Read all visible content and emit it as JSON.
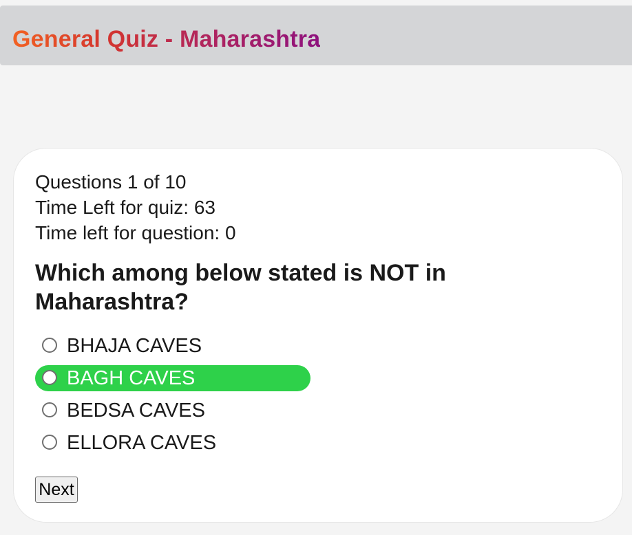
{
  "header": {
    "title": "General Quiz - Maharashtra"
  },
  "quiz": {
    "question_counter": "Questions 1 of 10",
    "time_left_quiz": "Time Left for quiz: 63",
    "time_left_question": "Time left for question: 0",
    "question": "Which among below stated is NOT in Maharashtra?",
    "options": [
      {
        "label": "BHAJA CAVES",
        "selected": false
      },
      {
        "label": "BAGH CAVES",
        "selected": true
      },
      {
        "label": "BEDSA CAVES",
        "selected": false
      },
      {
        "label": "ELLORA CAVES",
        "selected": false
      }
    ],
    "next_label": "Next"
  },
  "colors": {
    "header_bg": "#d4d5d7",
    "title_gradient_start": "#f26223",
    "title_gradient_end": "#8e127e",
    "selected_option_bg": "#2ed14a",
    "page_bg": "#f4f4f4",
    "card_bg": "#ffffff"
  }
}
